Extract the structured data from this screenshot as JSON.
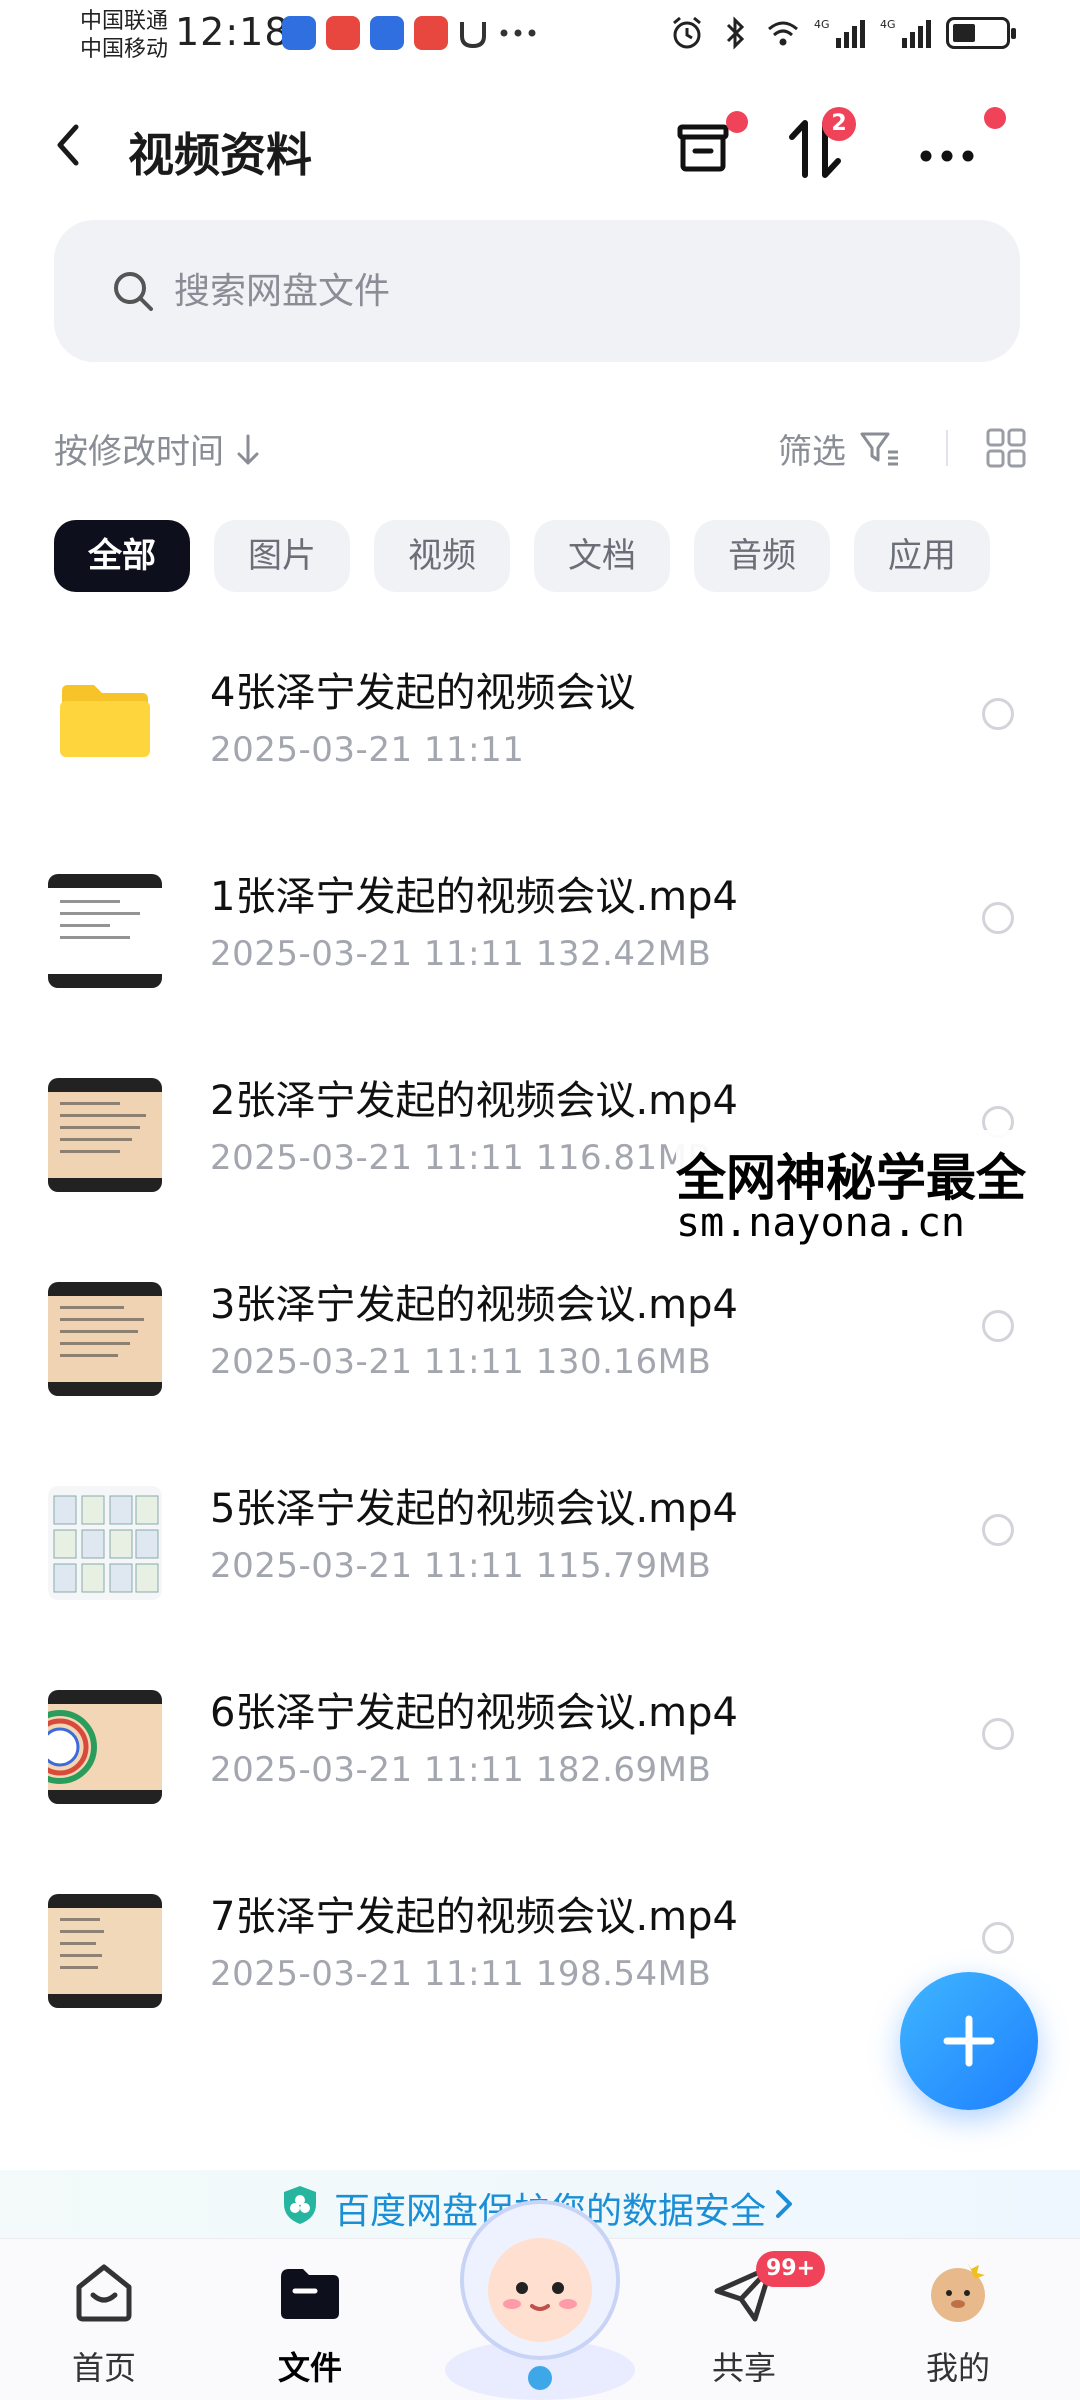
{
  "status_bar": {
    "carrier_1": "中国联通",
    "carrier_2": "中国移动",
    "time": "12:18",
    "network_1": "4G",
    "network_2": "4G"
  },
  "header": {
    "title": "视频资料",
    "transfer_badge": "2"
  },
  "search": {
    "placeholder": "搜索网盘文件"
  },
  "sort": {
    "label": "按修改时间",
    "filter_label": "筛选"
  },
  "categories": [
    "全部",
    "图片",
    "视频",
    "文档",
    "音频",
    "应用"
  ],
  "files": [
    {
      "name": "4张泽宁发起的视频会议",
      "meta": "2025-03-21   11:11",
      "type": "folder"
    },
    {
      "name": "1张泽宁发起的视频会议.mp4",
      "meta": "2025-03-21   11:11   132.42MB",
      "type": "video"
    },
    {
      "name": "2张泽宁发起的视频会议.mp4",
      "meta": "2025-03-21   11:11   116.81MB",
      "type": "video"
    },
    {
      "name": "3张泽宁发起的视频会议.mp4",
      "meta": "2025-03-21   11:11   130.16MB",
      "type": "video"
    },
    {
      "name": "5张泽宁发起的视频会议.mp4",
      "meta": "2025-03-21   11:11   115.79MB",
      "type": "video"
    },
    {
      "name": "6张泽宁发起的视频会议.mp4",
      "meta": "2025-03-21   11:11   182.69MB",
      "type": "video"
    },
    {
      "name": "7张泽宁发起的视频会议.mp4",
      "meta": "2025-03-21   11:11   198.54MB",
      "type": "video"
    }
  ],
  "watermark": {
    "line1": "全网神秘学最全",
    "line2": "sm.nayona.cn"
  },
  "banner": {
    "text": "百度网盘保护您的数据安全"
  },
  "bottom_nav": {
    "home": "首页",
    "files": "文件",
    "share": "共享",
    "share_badge": "99+",
    "mine": "我的"
  },
  "colors": {
    "accent": "#1e7fff",
    "badge": "#f0435a",
    "chip_active": "#0e0f1c",
    "meta_text": "#a3a6ae"
  }
}
